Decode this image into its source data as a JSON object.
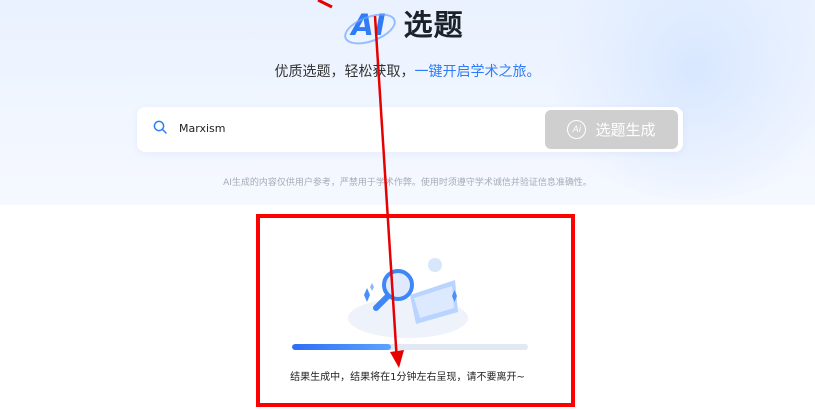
{
  "hero": {
    "title_ai": "AI",
    "title_rest": "选题",
    "subtitle_main": "优质选题，轻松获取，",
    "subtitle_highlight": "一键开启学术之旅。",
    "disclaimer": "AI生成的内容仅供用户参考，严禁用于学术作弊。使用时须遵守学术诚信并验证信息准确性。"
  },
  "search": {
    "icon": "search-icon",
    "value": "Marxism",
    "button_label": "选题生成",
    "button_icon_text": "Ai",
    "button_color": "#cfcfcf"
  },
  "progress": {
    "fraction": 0.42,
    "status_text": "结果生成中，结果将在1分钟左右呈现，请不要离开~"
  },
  "colors": {
    "accent": "#2f7cf6",
    "annotation": "#ff0000"
  }
}
